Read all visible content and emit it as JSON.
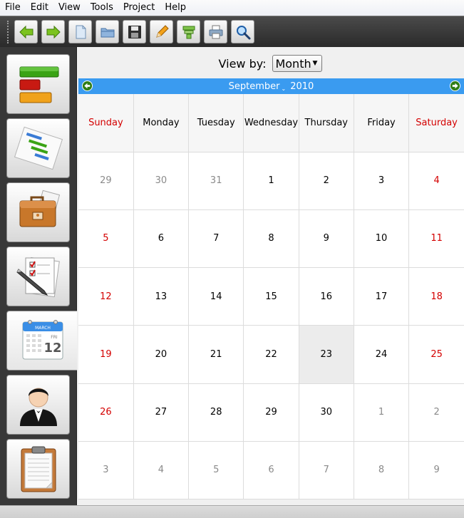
{
  "menu": [
    "File",
    "Edit",
    "View",
    "Tools",
    "Project",
    "Help"
  ],
  "toolbar": {
    "buttons": [
      "back-icon",
      "forward-icon",
      "new-document-icon",
      "open-folder-icon",
      "save-disk-icon",
      "pencil-icon",
      "layers-icon",
      "print-icon",
      "search-icon"
    ]
  },
  "sidebar": {
    "items": [
      "progress-bars-icon",
      "gantt-chart-icon",
      "briefcase-icon",
      "checklist-icon",
      "calendar-icon",
      "person-icon",
      "clipboard-icon"
    ],
    "active": "calendar-icon",
    "calendar_icon_text": {
      "month": "MARCH",
      "weekday": "FRI",
      "day": "12"
    }
  },
  "view_by": {
    "label": "View by:",
    "selected": "Month"
  },
  "month_bar": {
    "month": "September",
    "year": "2010"
  },
  "calendar": {
    "days": [
      "Sunday",
      "Monday",
      "Tuesday",
      "Wednesday",
      "Thursday",
      "Friday",
      "Saturday"
    ],
    "weeks": [
      [
        {
          "d": "29",
          "m": "other"
        },
        {
          "d": "30",
          "m": "other"
        },
        {
          "d": "31",
          "m": "other"
        },
        {
          "d": "1"
        },
        {
          "d": "2"
        },
        {
          "d": "3"
        },
        {
          "d": "4"
        }
      ],
      [
        {
          "d": "5"
        },
        {
          "d": "6"
        },
        {
          "d": "7"
        },
        {
          "d": "8"
        },
        {
          "d": "9"
        },
        {
          "d": "10"
        },
        {
          "d": "11"
        }
      ],
      [
        {
          "d": "12"
        },
        {
          "d": "13"
        },
        {
          "d": "14"
        },
        {
          "d": "15"
        },
        {
          "d": "16"
        },
        {
          "d": "17"
        },
        {
          "d": "18"
        }
      ],
      [
        {
          "d": "19"
        },
        {
          "d": "20"
        },
        {
          "d": "21"
        },
        {
          "d": "22"
        },
        {
          "d": "23",
          "today": true
        },
        {
          "d": "24"
        },
        {
          "d": "25"
        }
      ],
      [
        {
          "d": "26"
        },
        {
          "d": "27"
        },
        {
          "d": "28"
        },
        {
          "d": "29"
        },
        {
          "d": "30"
        },
        {
          "d": "1",
          "m": "other"
        },
        {
          "d": "2",
          "m": "other"
        }
      ],
      [
        {
          "d": "3",
          "m": "other"
        },
        {
          "d": "4",
          "m": "other"
        },
        {
          "d": "5",
          "m": "other"
        },
        {
          "d": "6",
          "m": "other"
        },
        {
          "d": "7",
          "m": "other"
        },
        {
          "d": "8",
          "m": "other"
        },
        {
          "d": "9",
          "m": "other"
        }
      ]
    ]
  },
  "colors": {
    "accent": "#3a9bf0",
    "weekend": "#d40000",
    "other_month": "#8a8a8a",
    "today_bg": "#ececec"
  }
}
